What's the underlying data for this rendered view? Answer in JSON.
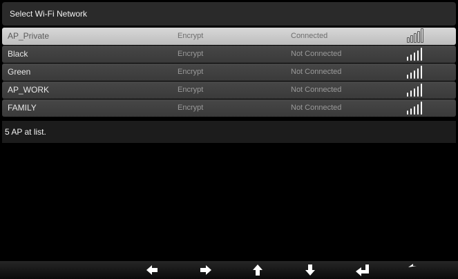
{
  "header": {
    "title": "Select Wi-Fi Network"
  },
  "networks": [
    {
      "ssid": "AP_Private",
      "encryption": "Encrypt",
      "status": "Connected",
      "selected": true,
      "signal_bars": 5
    },
    {
      "ssid": "Black",
      "encryption": "Encrypt",
      "status": "Not Connected",
      "selected": false,
      "signal_bars": 5
    },
    {
      "ssid": "Green",
      "encryption": "Encrypt",
      "status": "Not Connected",
      "selected": false,
      "signal_bars": 5
    },
    {
      "ssid": "AP_WORK",
      "encryption": "Encrypt",
      "status": "Not Connected",
      "selected": false,
      "signal_bars": 5
    },
    {
      "ssid": "FAMILY",
      "encryption": "Encrypt",
      "status": "Not Connected",
      "selected": false,
      "signal_bars": 5
    }
  ],
  "footer": {
    "status_text": "5 AP at list."
  },
  "nav_buttons": [
    {
      "icon": "arrow-left-icon",
      "label": "left"
    },
    {
      "icon": "arrow-right-icon",
      "label": "right"
    },
    {
      "icon": "arrow-up-icon",
      "label": "up"
    },
    {
      "icon": "arrow-down-icon",
      "label": "down"
    },
    {
      "icon": "enter-icon",
      "label": "enter"
    },
    {
      "icon": "back-icon",
      "label": "back"
    }
  ],
  "colors": {
    "background": "#000000",
    "row": "#404040",
    "row_selected": "#cfcfcf",
    "text": "#f2f2f2",
    "muted_text": "#9a9a9a"
  }
}
